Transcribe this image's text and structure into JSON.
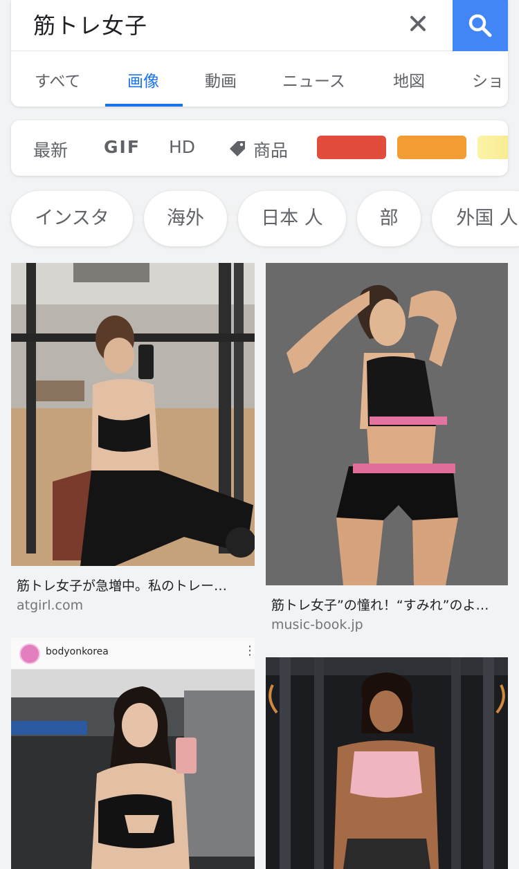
{
  "search": {
    "query": "筋トレ女子"
  },
  "tabs": [
    "すべて",
    "画像",
    "動画",
    "ニュース",
    "地図",
    "ショ"
  ],
  "filters": {
    "latest": "最新",
    "gif": "GIF",
    "hd": "HD",
    "products": "商品"
  },
  "color_swatches": [
    "#e24c3c",
    "#f29c33",
    "#f7e98a"
  ],
  "chips": [
    "インスタ",
    "海外",
    "日本 人",
    "部",
    "外国 人"
  ],
  "results": [
    {
      "caption": "筋トレ女子が急増中。私のトレー…",
      "source": "atgirl.com"
    },
    {
      "caption": "筋トレ女子”の憧れ！“すみれ”のよ…",
      "source": "music-book.jp"
    },
    {
      "account": "bodyonkorea"
    }
  ],
  "colors": {
    "accent": "#1a73e8",
    "search_button": "#4285f4"
  }
}
